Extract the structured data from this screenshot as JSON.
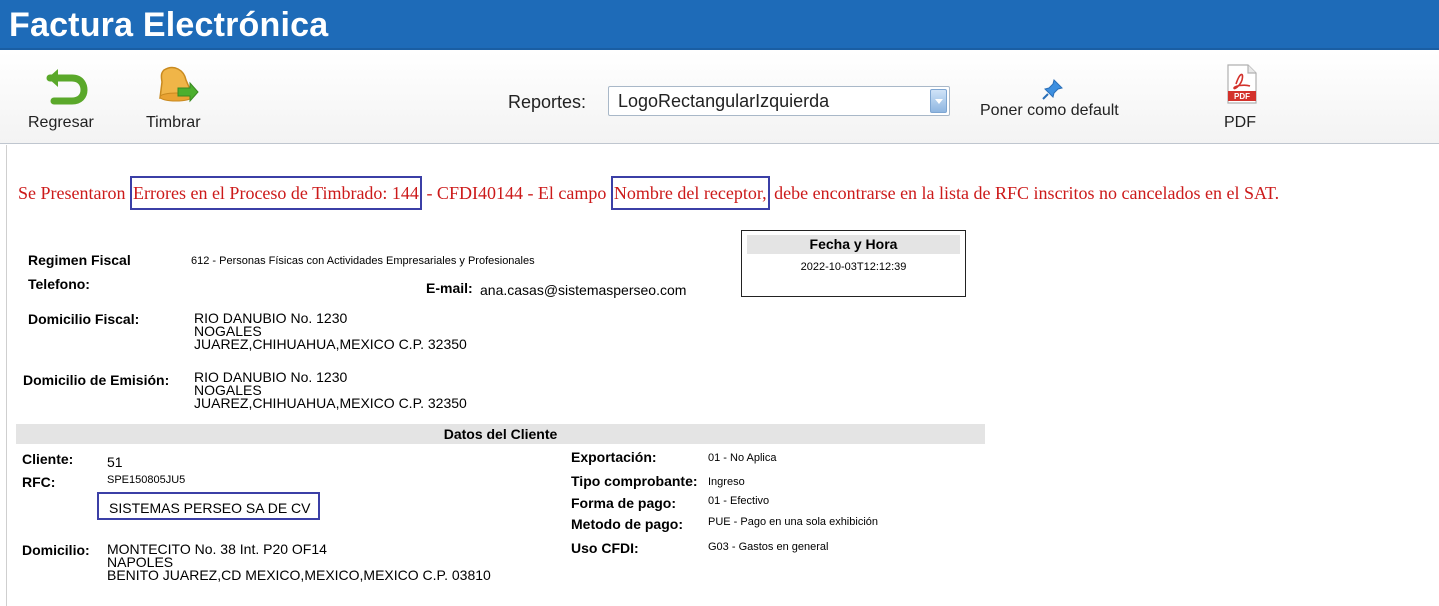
{
  "header": {
    "title": "Factura Electrónica"
  },
  "toolbar": {
    "regresar_label": "Regresar",
    "timbrar_label": "Timbrar",
    "reportes_label": "Reportes:",
    "reportes_value": "LogoRectangularIzquierda",
    "default_label": "Poner como default",
    "pdf_label": "PDF",
    "pdf_icon_text": "PDF"
  },
  "error": {
    "part1": "Se Presentaron ",
    "hl1": "Errores en el Proceso de Timbrado: 144",
    "part2": " - CFDI40144 - El campo ",
    "hl2": "Nombre del receptor,",
    "part3": " debe encontrarse en la lista de RFC inscritos no cancelados en el SAT."
  },
  "emisor": {
    "regimen_label": "Regimen Fiscal",
    "regimen_value": "612 - Personas Físicas con Actividades Empresariales y Profesionales",
    "telefono_label": "Telefono:",
    "email_label": "E-mail:",
    "email_value": "ana.casas@sistemasperseo.com",
    "domicilio_fiscal_label": "Domicilio Fiscal:",
    "domicilio_fiscal": [
      "RIO DANUBIO No. 1230",
      "NOGALES",
      "JUAREZ,CHIHUAHUA,MEXICO C.P. 32350"
    ],
    "domicilio_emision_label": "Domicilio de Emisión:",
    "domicilio_emision": [
      "RIO DANUBIO No. 1230",
      "NOGALES",
      "JUAREZ,CHIHUAHUA,MEXICO C.P. 32350"
    ]
  },
  "fecha": {
    "header": "Fecha y Hora",
    "value": "2022-10-03T12:12:39"
  },
  "cliente": {
    "section_title": "Datos del Cliente",
    "cliente_label": "Cliente:",
    "cliente_value": "51",
    "rfc_label": "RFC:",
    "rfc_value": "SPE150805JU5",
    "razon_social": "SISTEMAS PERSEO SA DE CV",
    "domicilio_label": "Domicilio:",
    "domicilio": [
      "MONTECITO No. 38 Int. P20 OF14",
      "NAPOLES",
      "BENITO JUAREZ,CD MEXICO,MEXICO,MEXICO C.P. 03810"
    ],
    "exportacion_label": "Exportación:",
    "exportacion_value": "01 - No Aplica",
    "tipo_label": "Tipo comprobante:",
    "tipo_value": "Ingreso",
    "forma_label": "Forma de pago:",
    "forma_value": "01 - Efectivo",
    "metodo_label": "Metodo de pago:",
    "metodo_value": "PUE - Pago en una sola exhibición",
    "uso_label": "Uso CFDI:",
    "uso_value": "G03 - Gastos en general"
  },
  "colors": {
    "header_bg": "#1e6bb8",
    "error_text": "#cc1a1a",
    "highlight_border": "#3b3fa6"
  }
}
